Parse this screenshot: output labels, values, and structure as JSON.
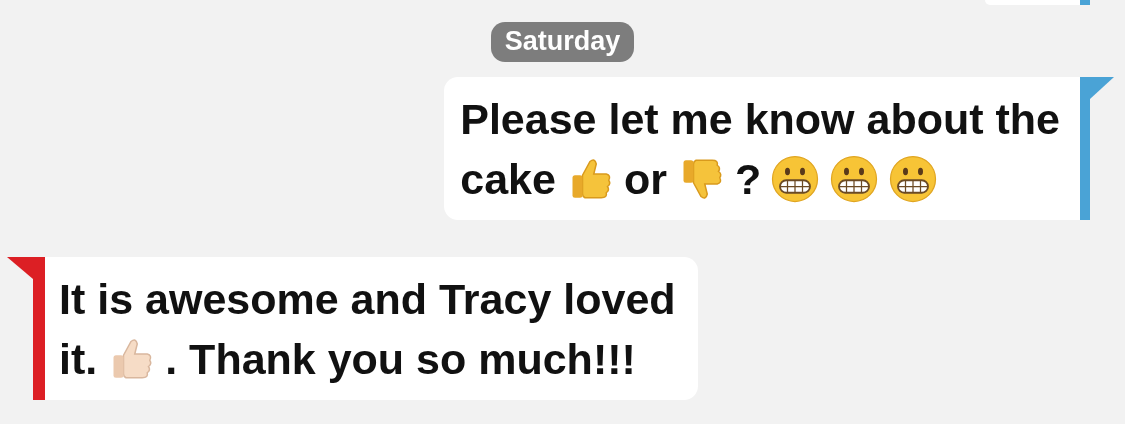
{
  "messages": [
    {
      "kind": "partial"
    },
    {
      "kind": "date",
      "text": "Saturday"
    },
    {
      "kind": "outgoing",
      "lines": [
        [
          {
            "kind": "text",
            "text": "Please let me know about the"
          }
        ],
        [
          {
            "kind": "text",
            "text": "cake"
          },
          {
            "kind": "thumbs_up"
          },
          {
            "kind": "text",
            "text": "or"
          },
          {
            "kind": "thumbs_down"
          },
          {
            "kind": "text",
            "text": "?"
          },
          {
            "kind": "grimace"
          },
          {
            "kind": "grimace"
          },
          {
            "kind": "grimace"
          }
        ]
      ]
    },
    {
      "kind": "incoming",
      "lines": [
        [
          {
            "kind": "text",
            "text": "It is awesome and Tracy loved"
          }
        ],
        [
          {
            "kind": "text",
            "text": "it."
          },
          {
            "kind": "thumbs_up_light"
          },
          {
            "kind": "text",
            "text": ". Thank you so much!!!"
          }
        ]
      ]
    }
  ]
}
